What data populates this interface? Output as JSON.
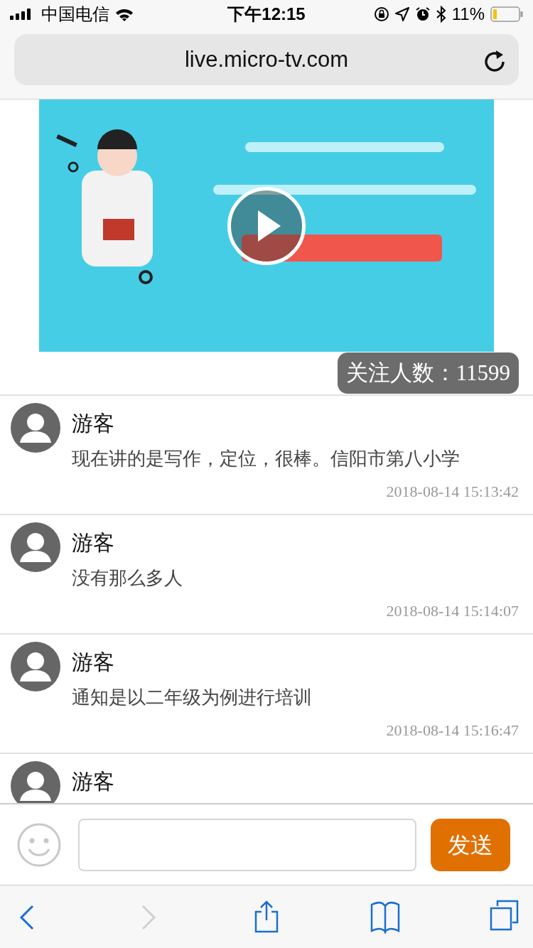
{
  "status_bar": {
    "carrier": "中国电信",
    "time": "下午12:15",
    "battery": "11%"
  },
  "address_bar": {
    "url": "live.micro-tv.com"
  },
  "follower_badge": "关注人数：11599",
  "messages": [
    {
      "name": "游客",
      "text": "现在讲的是写作，定位，很棒。信阳市第八小学",
      "time": "2018-08-14 15:13:42"
    },
    {
      "name": "游客",
      "text": "没有那么多人",
      "time": "2018-08-14 15:14:07"
    },
    {
      "name": "游客",
      "text": "通知是以二年级为例进行培训",
      "time": "2018-08-14 15:16:47"
    },
    {
      "name": "游客"
    }
  ],
  "composer": {
    "send_label": "发送"
  },
  "toolbar": [
    {
      "kind": "back",
      "disabled": false
    },
    {
      "kind": "forward",
      "disabled": true
    },
    {
      "kind": "share",
      "disabled": false
    },
    {
      "kind": "bookmarks",
      "disabled": false
    },
    {
      "kind": "tabs",
      "disabled": false
    }
  ]
}
